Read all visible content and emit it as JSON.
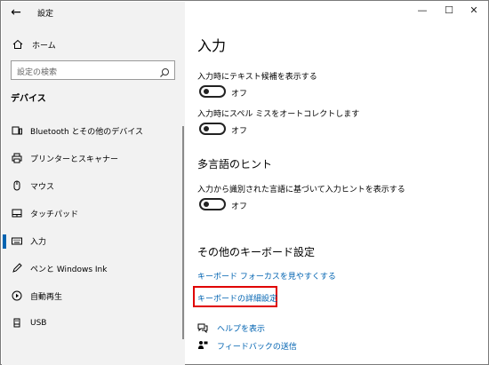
{
  "window": {
    "title": "設定",
    "back_icon": "←",
    "minimize_icon": "—",
    "maximize_icon": "☐",
    "close_icon": "✕"
  },
  "sidebar": {
    "home_label": "ホーム",
    "search_placeholder": "設定の検索",
    "section_title": "デバイス",
    "items": [
      {
        "label": "Bluetooth とその他のデバイス",
        "icon": "bluetooth-devices-icon"
      },
      {
        "label": "プリンターとスキャナー",
        "icon": "printer-icon"
      },
      {
        "label": "マウス",
        "icon": "mouse-icon"
      },
      {
        "label": "タッチパッド",
        "icon": "touchpad-icon"
      },
      {
        "label": "入力",
        "icon": "keyboard-icon",
        "selected": true
      },
      {
        "label": "ペンと Windows Ink",
        "icon": "pen-icon"
      },
      {
        "label": "自動再生",
        "icon": "autoplay-icon"
      },
      {
        "label": "USB",
        "icon": "usb-icon"
      }
    ]
  },
  "main": {
    "title": "入力",
    "settings": [
      {
        "label": "入力時にテキスト候補を表示する",
        "state": "オフ"
      },
      {
        "label": "入力時にスペル ミスをオートコレクトします",
        "state": "オフ"
      }
    ],
    "multilingual": {
      "title": "多言語のヒント",
      "label": "入力から識別された言語に基づいて入力ヒントを表示する",
      "state": "オフ"
    },
    "other_keyboard": {
      "title": "その他のキーボード設定",
      "links": [
        "キーボード フォーカスを見やすくする",
        "キーボードの詳細設定"
      ]
    },
    "help": {
      "show_help": "ヘルプを表示",
      "feedback": "フィードバックの送信"
    }
  },
  "colors": {
    "accent": "#0063b1",
    "highlight": "#e00000",
    "sidebar_bg": "#f2f2f2"
  }
}
